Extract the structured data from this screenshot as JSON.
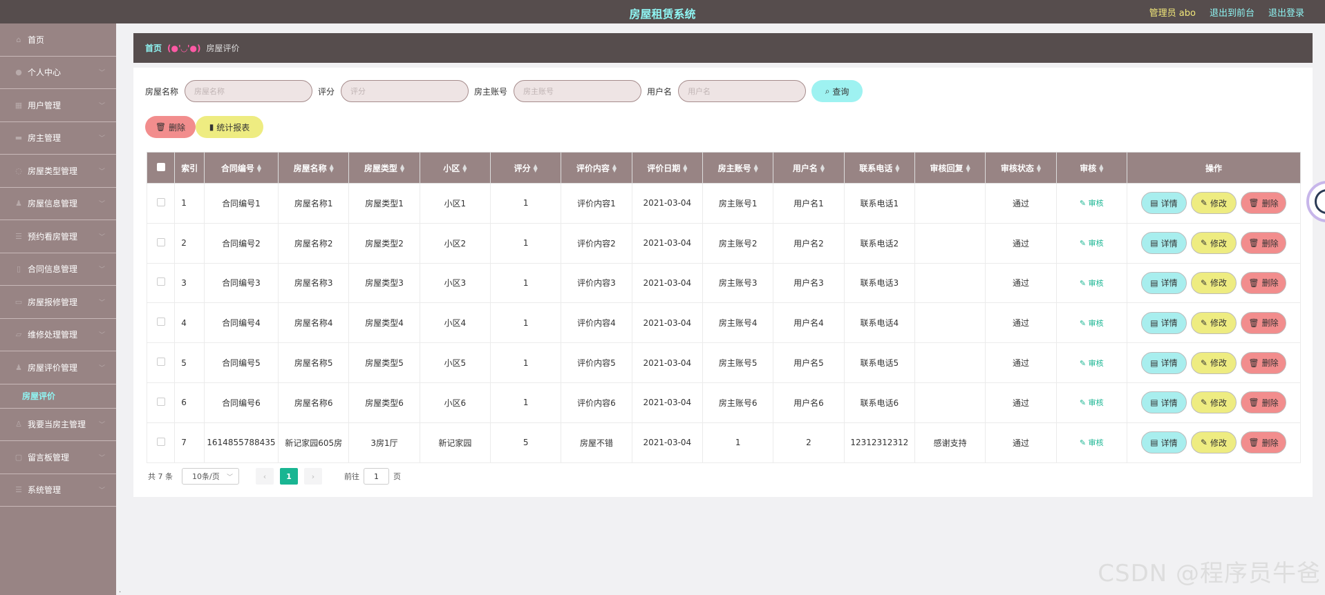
{
  "header": {
    "title": "房屋租赁系统",
    "admin": "管理员 abo",
    "front_link": "退出到前台",
    "logout_link": "退出登录"
  },
  "sidebar": {
    "items": [
      {
        "label": "首页",
        "icon": "home-icon"
      },
      {
        "label": "个人中心",
        "icon": "user-icon"
      },
      {
        "label": "用户管理",
        "icon": "users-icon"
      },
      {
        "label": "房主管理",
        "icon": "owner-icon"
      },
      {
        "label": "房屋类型管理",
        "icon": "type-icon"
      },
      {
        "label": "房屋信息管理",
        "icon": "house-icon"
      },
      {
        "label": "预约看房管理",
        "icon": "calendar-icon"
      },
      {
        "label": "合同信息管理",
        "icon": "contract-icon"
      },
      {
        "label": "房屋报修管理",
        "icon": "repair-icon"
      },
      {
        "label": "维修处理管理",
        "icon": "tool-icon"
      },
      {
        "label": "房屋评价管理",
        "icon": "review-icon"
      }
    ],
    "active_sub": "房屋评价",
    "items_after": [
      {
        "label": "我要当房主管理",
        "icon": "apply-icon"
      },
      {
        "label": "留言板管理",
        "icon": "message-icon"
      },
      {
        "label": "系统管理",
        "icon": "settings-icon"
      }
    ]
  },
  "breadcrumb": {
    "home": "首页",
    "separator": "(●'◡'●)",
    "current": "房屋评价"
  },
  "search": {
    "fields": [
      {
        "label": "房屋名称",
        "placeholder": "房屋名称"
      },
      {
        "label": "评分",
        "placeholder": "评分"
      },
      {
        "label": "房主账号",
        "placeholder": "房主账号"
      },
      {
        "label": "用户名",
        "placeholder": "用户名"
      }
    ],
    "query_label": "查询"
  },
  "actions": {
    "delete_label": "删除",
    "report_label": "统计报表"
  },
  "table": {
    "headers": [
      "索引",
      "合同编号",
      "房屋名称",
      "房屋类型",
      "小区",
      "评分",
      "评价内容",
      "评价日期",
      "房主账号",
      "用户名",
      "联系电话",
      "审核回复",
      "审核状态",
      "审核",
      "操作"
    ],
    "rows": [
      [
        "1",
        "合同编号1",
        "房屋名称1",
        "房屋类型1",
        "小区1",
        "1",
        "评价内容1",
        "2021-03-04",
        "房主账号1",
        "用户名1",
        "联系电话1",
        "",
        "通过"
      ],
      [
        "2",
        "合同编号2",
        "房屋名称2",
        "房屋类型2",
        "小区2",
        "1",
        "评价内容2",
        "2021-03-04",
        "房主账号2",
        "用户名2",
        "联系电话2",
        "",
        "通过"
      ],
      [
        "3",
        "合同编号3",
        "房屋名称3",
        "房屋类型3",
        "小区3",
        "1",
        "评价内容3",
        "2021-03-04",
        "房主账号3",
        "用户名3",
        "联系电话3",
        "",
        "通过"
      ],
      [
        "4",
        "合同编号4",
        "房屋名称4",
        "房屋类型4",
        "小区4",
        "1",
        "评价内容4",
        "2021-03-04",
        "房主账号4",
        "用户名4",
        "联系电话4",
        "",
        "通过"
      ],
      [
        "5",
        "合同编号5",
        "房屋名称5",
        "房屋类型5",
        "小区5",
        "1",
        "评价内容5",
        "2021-03-04",
        "房主账号5",
        "用户名5",
        "联系电话5",
        "",
        "通过"
      ],
      [
        "6",
        "合同编号6",
        "房屋名称6",
        "房屋类型6",
        "小区6",
        "1",
        "评价内容6",
        "2021-03-04",
        "房主账号6",
        "用户名6",
        "联系电话6",
        "",
        "通过"
      ],
      [
        "7",
        "1614855788435",
        "新记家园605房",
        "3房1厅",
        "新记家园",
        "5",
        "房屋不错",
        "2021-03-04",
        "1",
        "2",
        "12312312312",
        "感谢支持",
        "通过"
      ]
    ],
    "review_label": "审核",
    "detail_label": "详情",
    "edit_label": "修改",
    "delete_label": "删除"
  },
  "pager": {
    "total": "共 7 条",
    "page_size": "10条/页",
    "current_page": "1",
    "goto_prefix": "前往",
    "goto_value": "1",
    "goto_suffix": "页"
  },
  "watermark": "CSDN @程序员牛爸",
  "colors": {
    "header_bg": "#564d4d",
    "sidebar_bg": "#988484",
    "accent_cyan": "#8ff5f3",
    "accent_yellow": "#eeec81",
    "accent_red": "#f28d8d",
    "accent_green": "#19b592"
  }
}
